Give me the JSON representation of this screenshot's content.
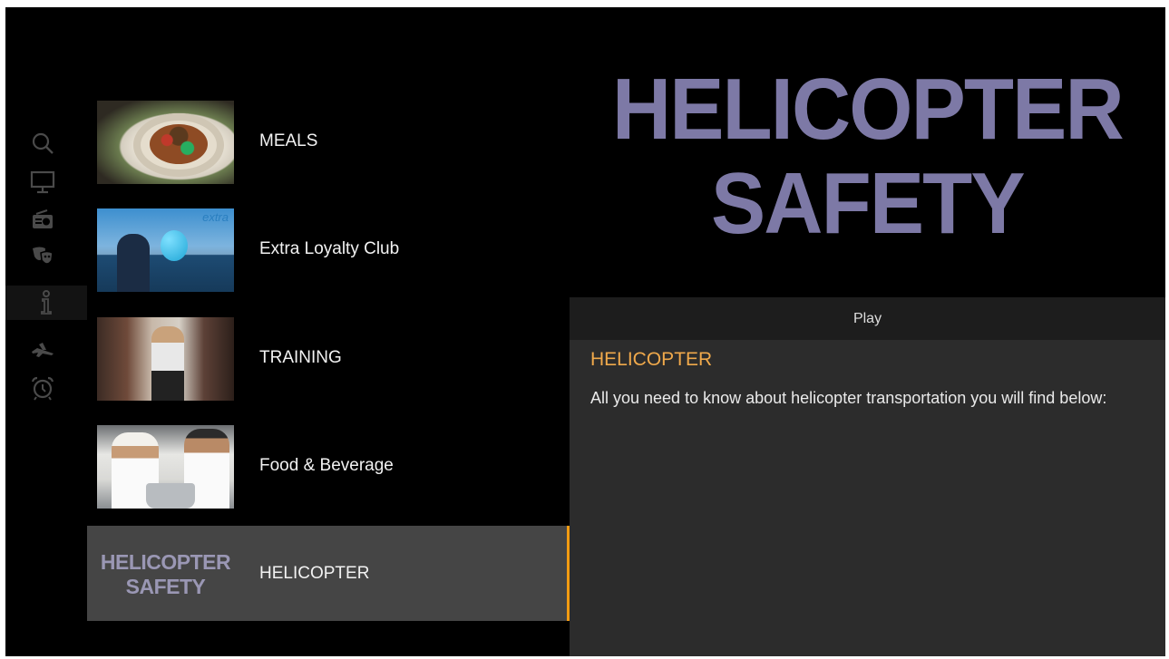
{
  "sidebar": {
    "items": [
      {
        "icon": "search-icon"
      },
      {
        "icon": "tv-icon"
      },
      {
        "icon": "radio-icon"
      },
      {
        "icon": "theater-masks-icon"
      },
      {
        "icon": "info-icon",
        "active": true
      },
      {
        "icon": "airplane-icon"
      },
      {
        "icon": "alarm-clock-icon"
      }
    ]
  },
  "list": {
    "items": [
      {
        "label": "MEALS"
      },
      {
        "label": "Extra Loyalty Club",
        "thumb_logo": "extra"
      },
      {
        "label": "TRAINING"
      },
      {
        "label": "Food & Beverage"
      },
      {
        "label": "HELICOPTER",
        "selected": true,
        "thumb_line1": "HELICOPTER",
        "thumb_line2": "SAFETY"
      }
    ]
  },
  "detail": {
    "hero_line1": "HELICOPTER",
    "hero_line2": "SAFETY",
    "play_label": "Play",
    "title": "HELICOPTER",
    "description": "All you need to know about helicopter transportation you will find below:"
  },
  "colors": {
    "accent": "#f39c12",
    "title": "#f0a94b",
    "selected_row": "#454545",
    "panel": "#2c2c2c"
  }
}
